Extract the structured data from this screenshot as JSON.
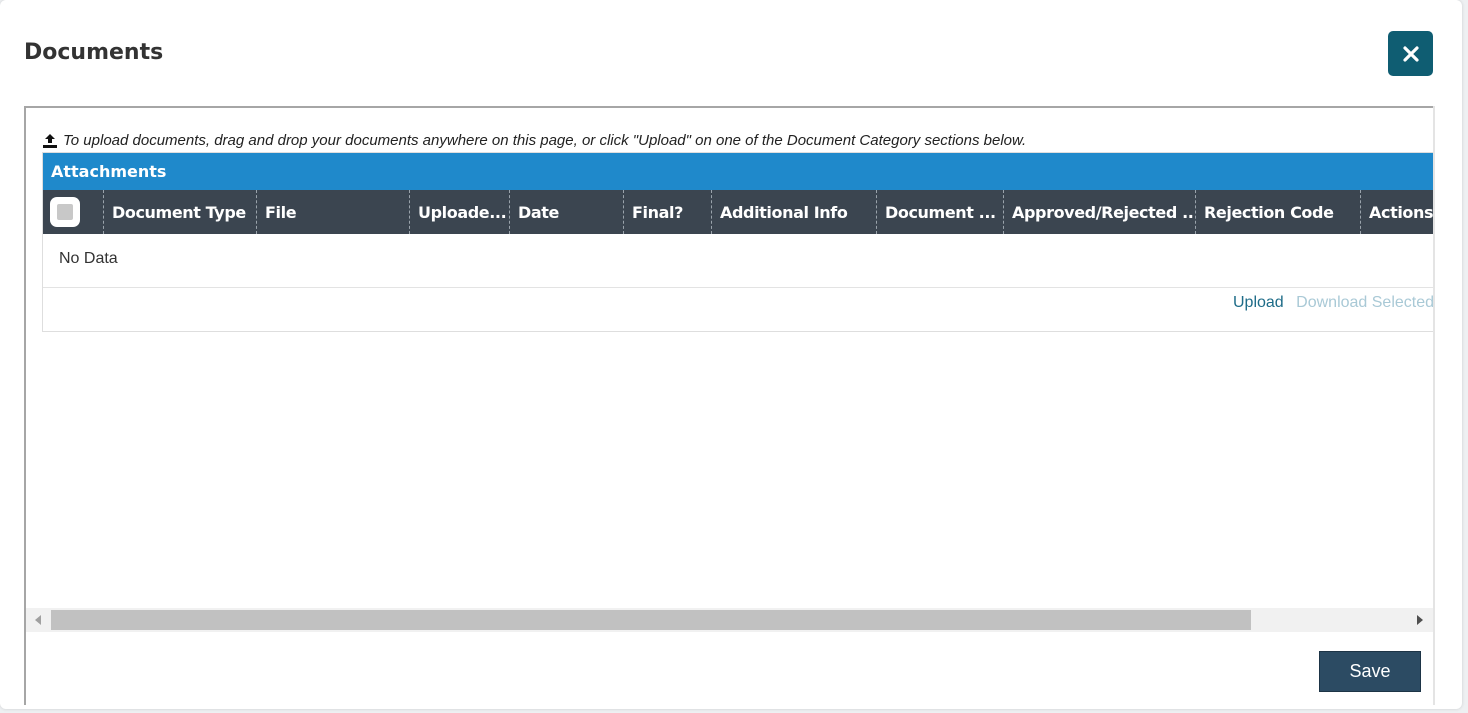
{
  "dialog": {
    "title": "Documents",
    "close_icon": "close-icon"
  },
  "hint": {
    "icon": "upload-icon",
    "text": "To upload documents, drag and drop your documents anywhere on this page, or click \"Upload\" on one of the Document Category sections below."
  },
  "attachments": {
    "header": "Attachments",
    "columns": [
      "Document Type",
      "File",
      "Uploade...",
      "Date",
      "Final?",
      "Additional Info",
      "Document ...",
      "Approved/Rejected ...",
      "Rejection Code",
      "Actions"
    ],
    "empty_text": "No Data",
    "upload_label": "Upload",
    "download_selected_label": "Download Selected"
  },
  "footer": {
    "save_label": "Save"
  },
  "colors": {
    "header_blue": "#1f89cb",
    "column_header": "#3b4550",
    "close_button": "#0f5d72",
    "save_button": "#2c4b63"
  }
}
